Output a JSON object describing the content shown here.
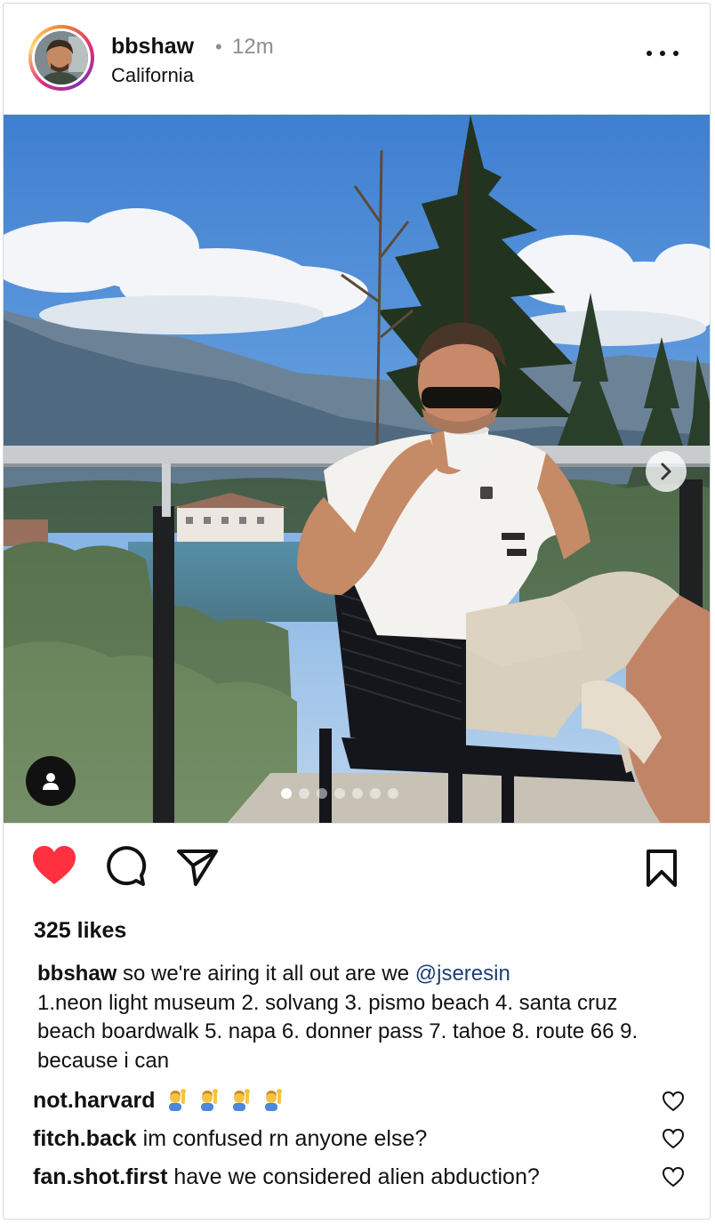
{
  "post": {
    "username": "bbshaw",
    "separator": "•",
    "time": "12m",
    "location": "California",
    "more_icon": "more-horizontal-icon"
  },
  "carousel": {
    "slide_count": 7,
    "active_index": 0,
    "next_icon": "chevron-right-icon",
    "tag_icon": "user-tag-icon"
  },
  "actions": {
    "like_icon": "heart-filled-icon",
    "like_color": "#ff3040",
    "comment_icon": "comment-icon",
    "share_icon": "send-icon",
    "save_icon": "bookmark-icon"
  },
  "likes_text": "325 likes",
  "caption": {
    "username": "bbshaw",
    "text": " so we're airing it all out are we ",
    "mention": "@jseresin",
    "list": "1.neon light museum 2. solvang 3. pismo beach 4. santa cruz beach boardwalk 5. napa 6. donner pass 7. tahoe 8. route 66 9. because i can"
  },
  "comments": [
    {
      "username": "not.harvard",
      "text": "",
      "emoji": "person-raising-hand-emoji",
      "emoji_count": 4
    },
    {
      "username": "fitch.back",
      "text": " im confused rn anyone else?"
    },
    {
      "username": "fan.shot.first",
      "text": " have we considered alien abduction?"
    }
  ]
}
